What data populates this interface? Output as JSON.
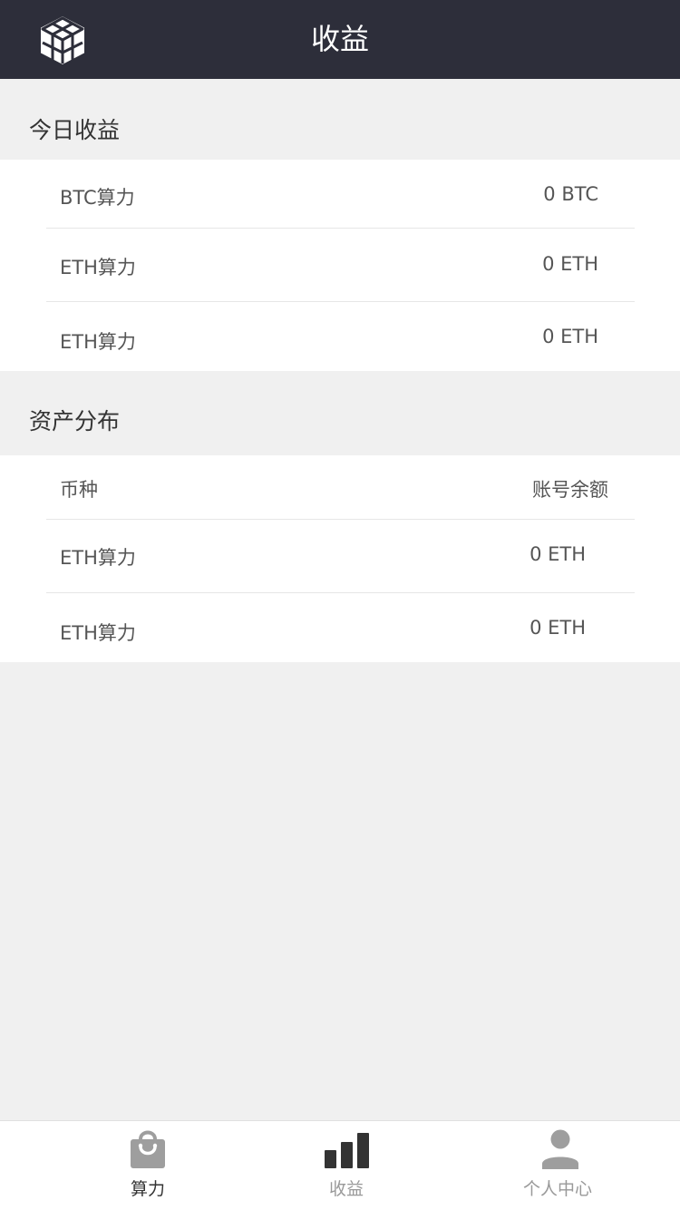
{
  "header": {
    "title": "收益",
    "logo_icon": "cube-logo-icon"
  },
  "today": {
    "title": "今日收益",
    "rows": [
      {
        "label": "BTC算力",
        "value": "0 BTC"
      },
      {
        "label": "ETH算力",
        "value": "0 ETH"
      },
      {
        "label": "ETH算力",
        "value": "0 ETH"
      }
    ]
  },
  "assets": {
    "title": "资产分布",
    "header": {
      "label": "币种",
      "value": "账号余额"
    },
    "rows": [
      {
        "label": "ETH算力",
        "value": "0 ETH"
      },
      {
        "label": "ETH算力",
        "value": "0 ETH"
      }
    ]
  },
  "tabbar": {
    "tabs": [
      {
        "label": "算力",
        "icon": "shopping-bag-icon",
        "active": true
      },
      {
        "label": "收益",
        "icon": "bar-chart-icon",
        "active": false
      },
      {
        "label": "个人中心",
        "icon": "user-icon",
        "active": false
      }
    ]
  },
  "colors": {
    "header_bg": "#2d2e3a",
    "page_bg": "#f0f0f0",
    "icon_active": "#9e9e9e",
    "icon_inactive": "#333333"
  }
}
